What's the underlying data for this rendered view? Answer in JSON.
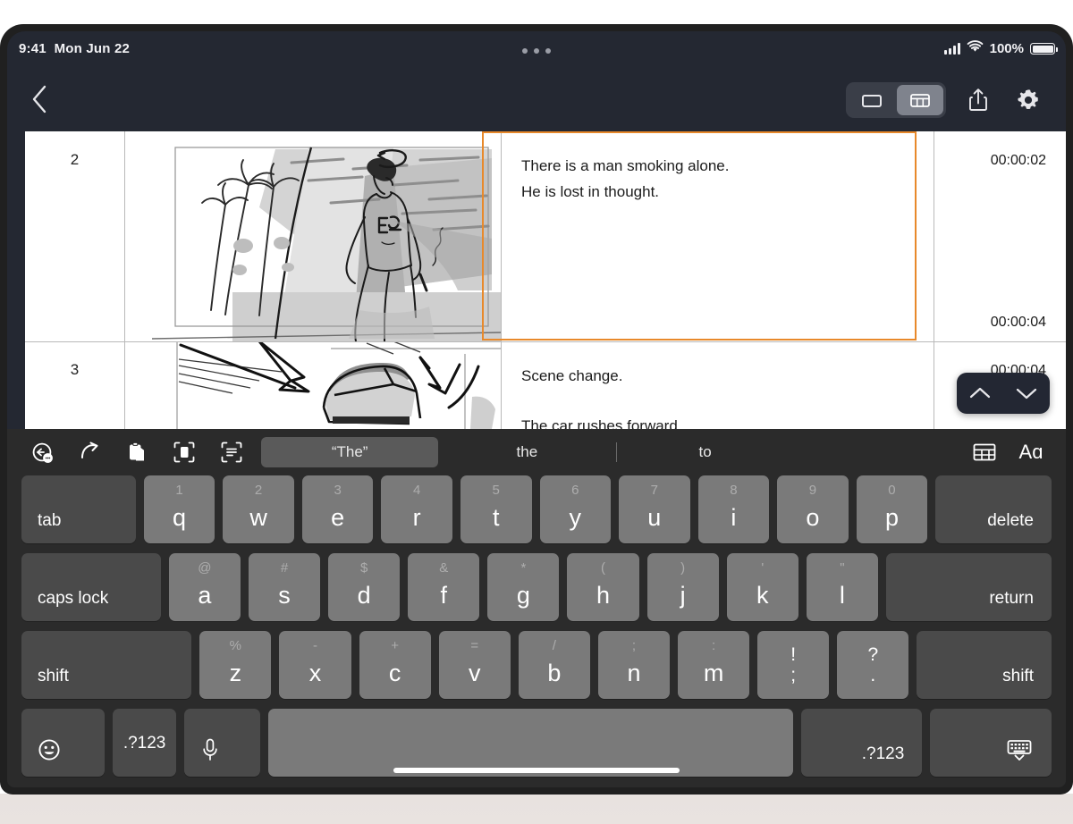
{
  "status_bar": {
    "time": "9:41",
    "date": "Mon Jun 22",
    "battery_percent": "100%",
    "signal_icon": "cellular-signal-icon",
    "wifi_icon": "wifi-icon",
    "battery_icon": "battery-icon",
    "multitask_handle_icon": "multitask-handle-icon"
  },
  "navbar": {
    "back_icon": "back-chevron-icon",
    "view_modes": [
      {
        "name": "single-view",
        "icon": "single-pane-icon",
        "selected": false
      },
      {
        "name": "grid-view",
        "icon": "grid-view-icon",
        "selected": true
      }
    ],
    "share_icon": "share-icon",
    "settings_icon": "gear-icon"
  },
  "storyboard": {
    "rows": [
      {
        "number": "2",
        "thumbnail_alt": "man-smoking-on-beach-sketch",
        "text_lines": [
          "There is a man smoking alone.",
          "He is lost in thought."
        ],
        "time_start": "00:00:02",
        "time_end": "00:00:04",
        "selected": true
      },
      {
        "number": "3",
        "thumbnail_alt": "car-rushing-forward-sketch",
        "text_lines": [
          "Scene change.",
          "The car rushes forward."
        ],
        "time_start": "00:00:04",
        "time_end": "",
        "selected": false
      }
    ],
    "selection_color": "#e8892b",
    "floating_nav": {
      "up_icon": "chevron-up-icon",
      "down_icon": "chevron-down-icon"
    }
  },
  "keyboard": {
    "predictive_bar": {
      "icons": [
        {
          "name": "undo-icon"
        },
        {
          "name": "redo-icon"
        },
        {
          "name": "paste-icon"
        },
        {
          "name": "scan-document-icon"
        },
        {
          "name": "scan-text-icon"
        }
      ],
      "suggestions": [
        {
          "text": "“The”",
          "highlighted": true
        },
        {
          "text": "the",
          "highlighted": false
        },
        {
          "text": "to",
          "highlighted": false
        }
      ],
      "right_icons": [
        {
          "name": "table-icon",
          "label": ""
        },
        {
          "name": "format-text-icon",
          "label": "Aɑ"
        }
      ]
    },
    "rows": [
      [
        {
          "main": "tab",
          "alt": "",
          "style": "dark-left",
          "flex": 1.38
        },
        {
          "main": "q",
          "alt": "1",
          "style": "letter",
          "flex": 1
        },
        {
          "main": "w",
          "alt": "2",
          "style": "letter",
          "flex": 1
        },
        {
          "main": "e",
          "alt": "3",
          "style": "letter",
          "flex": 1
        },
        {
          "main": "r",
          "alt": "4",
          "style": "letter",
          "flex": 1
        },
        {
          "main": "t",
          "alt": "5",
          "style": "letter",
          "flex": 1
        },
        {
          "main": "y",
          "alt": "6",
          "style": "letter",
          "flex": 1
        },
        {
          "main": "u",
          "alt": "7",
          "style": "letter",
          "flex": 1
        },
        {
          "main": "i",
          "alt": "8",
          "style": "letter",
          "flex": 1
        },
        {
          "main": "o",
          "alt": "9",
          "style": "letter",
          "flex": 1
        },
        {
          "main": "p",
          "alt": "0",
          "style": "letter",
          "flex": 1
        },
        {
          "main": "delete",
          "alt": "",
          "style": "dark-right",
          "flex": 1.38
        }
      ],
      [
        {
          "main": "caps lock",
          "alt": "",
          "style": "dark-left",
          "flex": 1.72
        },
        {
          "main": "a",
          "alt": "@",
          "style": "letter",
          "flex": 1
        },
        {
          "main": "s",
          "alt": "#",
          "style": "letter",
          "flex": 1
        },
        {
          "main": "d",
          "alt": "$",
          "style": "letter",
          "flex": 1
        },
        {
          "main": "f",
          "alt": "&",
          "style": "letter",
          "flex": 1
        },
        {
          "main": "g",
          "alt": "*",
          "style": "letter",
          "flex": 1
        },
        {
          "main": "h",
          "alt": "(",
          "style": "letter",
          "flex": 1
        },
        {
          "main": "j",
          "alt": ")",
          "style": "letter",
          "flex": 1
        },
        {
          "main": "k",
          "alt": "'",
          "style": "letter",
          "flex": 1
        },
        {
          "main": "l",
          "alt": "\"",
          "style": "letter",
          "flex": 1
        },
        {
          "main": "return",
          "alt": "",
          "style": "dark-right",
          "flex": 2.06
        }
      ],
      [
        {
          "main": "shift",
          "alt": "",
          "style": "dark-left",
          "flex": 2.15
        },
        {
          "main": "z",
          "alt": "%",
          "style": "letter",
          "flex": 1
        },
        {
          "main": "x",
          "alt": "-",
          "style": "letter",
          "flex": 1
        },
        {
          "main": "c",
          "alt": "+",
          "style": "letter",
          "flex": 1
        },
        {
          "main": "v",
          "alt": "=",
          "style": "letter",
          "flex": 1
        },
        {
          "main": "b",
          "alt": "/",
          "style": "letter",
          "flex": 1
        },
        {
          "main": "n",
          "alt": ";",
          "style": "letter",
          "flex": 1
        },
        {
          "main": "m",
          "alt": ":",
          "style": "letter",
          "flex": 1
        },
        {
          "main": ";",
          "alt": "!",
          "style": "dual",
          "flex": 1
        },
        {
          "main": ".",
          "alt": "?",
          "style": "dual",
          "flex": 1
        },
        {
          "main": "shift",
          "alt": "",
          "style": "dark-right",
          "flex": 1.63
        }
      ],
      [
        {
          "main": "",
          "alt": "",
          "style": "dark-icon",
          "icon": "emoji-icon",
          "flex": 0.88
        },
        {
          "main": ".?123",
          "alt": "",
          "style": "dark-center",
          "flex": 0.84
        },
        {
          "main": "",
          "alt": "",
          "style": "dark-icon",
          "icon": "microphone-icon",
          "flex": 0.78
        },
        {
          "main": "",
          "alt": "",
          "style": "space",
          "flex": 6.9
        },
        {
          "main": ".?123",
          "alt": "",
          "style": "dark-right",
          "flex": 1.36
        },
        {
          "main": "",
          "alt": "",
          "style": "dark-icon",
          "icon": "dismiss-keyboard-icon",
          "flex": 1.36
        }
      ]
    ]
  },
  "home_indicator": "home-indicator"
}
